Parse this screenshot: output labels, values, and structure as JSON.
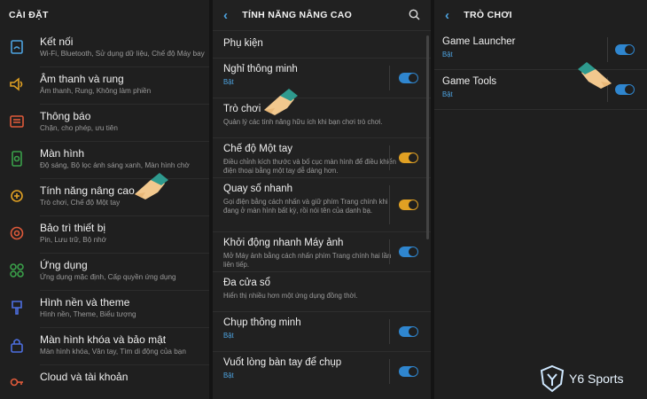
{
  "settings": {
    "header": "CÀI ĐẶT",
    "items": [
      {
        "title": "Kết nối",
        "sub": "Wi-Fi, Bluetooth, Sử dụng dữ liệu, Chế độ Máy bay",
        "icon": "wifi-file-icon",
        "color": "#4da3e0"
      },
      {
        "title": "Âm thanh và rung",
        "sub": "Âm thanh, Rung, Không làm phiền",
        "icon": "speaker-icon",
        "color": "#e0a023"
      },
      {
        "title": "Thông báo",
        "sub": "Chặn, cho phép, ưu tiên",
        "icon": "notification-icon",
        "color": "#e05a3a"
      },
      {
        "title": "Màn hình",
        "sub": "Độ sáng, Bộ lọc ánh sáng xanh, Màn hình chờ",
        "icon": "display-icon",
        "color": "#3aa04a"
      },
      {
        "title": "Tính năng nâng cao",
        "sub": "Trò chơi, Chế độ Một tay",
        "icon": "gear-plus-icon",
        "color": "#e0a023"
      },
      {
        "title": "Bảo trì thiết bị",
        "sub": "Pin, Lưu trữ, Bộ nhớ",
        "icon": "maintenance-icon",
        "color": "#e05a3a"
      },
      {
        "title": "Ứng dụng",
        "sub": "Ứng dụng mặc định, Cấp quyền ứng dụng",
        "icon": "apps-icon",
        "color": "#3aa04a"
      },
      {
        "title": "Hình nền và theme",
        "sub": "Hình nền, Theme, Biểu tượng",
        "icon": "brush-icon",
        "color": "#4d6fe0"
      },
      {
        "title": "Màn hình khóa và bảo mật",
        "sub": "Màn hình khóa, Vân tay, Tìm di động của bạn",
        "icon": "lock-icon",
        "color": "#4d6fe0"
      },
      {
        "title": "Cloud và tài khoản",
        "sub": "",
        "icon": "key-icon",
        "color": "#e05a3a"
      }
    ]
  },
  "advanced": {
    "header": "TÍNH NĂNG NÂNG CAO",
    "items": [
      {
        "title": "Phụ kiện",
        "sub": "",
        "sub_blue": false,
        "toggle": "none"
      },
      {
        "title": "Nghỉ thông minh",
        "sub": "Bật",
        "sub_blue": true,
        "toggle": "blue"
      },
      {
        "title": "Trò chơi",
        "sub": "Quản lý các tính năng hữu ích khi bạn chơi trò chơi.",
        "sub_blue": false,
        "toggle": "none"
      },
      {
        "title": "Chế độ Một tay",
        "sub": "Điều chỉnh kích thước và bố cục màn hình để điều khiển điện thoại bằng một tay dễ dàng hơn.",
        "sub_blue": false,
        "toggle": "orange"
      },
      {
        "title": "Quay số nhanh",
        "sub": "Gọi điện bằng cách nhấn và giữ phím Trang chính khi đang ở màn hình bất kỳ, rồi nói tên của danh bạ.",
        "sub_blue": false,
        "toggle": "orange"
      },
      {
        "title": "Khởi động nhanh Máy ảnh",
        "sub": "Mở Máy ảnh bằng cách nhấn phím Trang chính hai lần liên tiếp.",
        "sub_blue": false,
        "toggle": "blue"
      },
      {
        "title": "Đa cửa sổ",
        "sub": "Hiển thị nhiều hơn một ứng dụng đồng thời.",
        "sub_blue": false,
        "toggle": "none"
      },
      {
        "title": "Chụp thông minh",
        "sub": "Bật",
        "sub_blue": true,
        "toggle": "blue"
      },
      {
        "title": "Vuốt lòng bàn tay để chụp",
        "sub": "Bật",
        "sub_blue": true,
        "toggle": "blue"
      }
    ]
  },
  "games": {
    "header": "TRÒ CHƠI",
    "items": [
      {
        "title": "Game Launcher",
        "sub": "Bật",
        "toggle": "blue"
      },
      {
        "title": "Game Tools",
        "sub": "Bật",
        "toggle": "blue"
      }
    ]
  },
  "watermark": {
    "text": "Y6 Sports"
  },
  "colors": {
    "accent": "#4da3e0",
    "toggle_on": "#2f86cf",
    "toggle_orange": "#e0a023",
    "background": "#1f1f1f"
  }
}
